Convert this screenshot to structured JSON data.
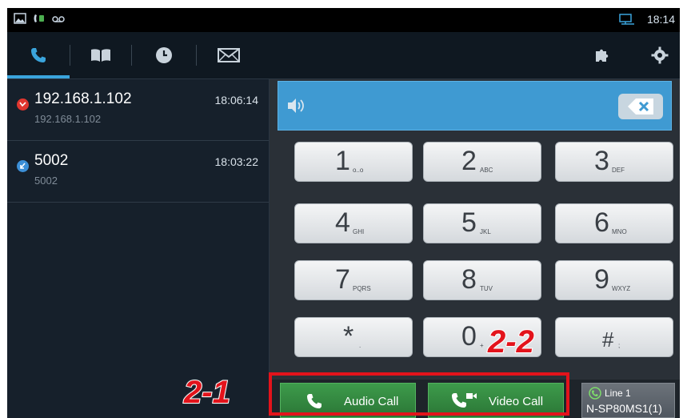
{
  "status_bar": {
    "time": "18:14"
  },
  "tabs": [
    {
      "name": "dialer",
      "icon": "phone-icon",
      "active": true
    },
    {
      "name": "directory",
      "icon": "book-icon",
      "active": false
    },
    {
      "name": "history",
      "icon": "clock-icon",
      "active": false
    },
    {
      "name": "messages",
      "icon": "envelope-icon",
      "active": false
    }
  ],
  "toolbar_icons": [
    "puzzle-icon",
    "gear-icon"
  ],
  "call_history": [
    {
      "title": "192.168.1.102",
      "subtitle": "192.168.1.102",
      "time": "18:06:14",
      "type": "missed",
      "icon_color": "#e0362f"
    },
    {
      "title": "5002",
      "subtitle": "5002",
      "time": "18:03:22",
      "type": "incoming",
      "icon_color": "#3c8fd6"
    }
  ],
  "keypad": [
    {
      "digit": "1",
      "letters": "o..o"
    },
    {
      "digit": "2",
      "letters": "ABC"
    },
    {
      "digit": "3",
      "letters": "DEF"
    },
    {
      "digit": "4",
      "letters": "GHI"
    },
    {
      "digit": "5",
      "letters": "JKL"
    },
    {
      "digit": "6",
      "letters": "MNO"
    },
    {
      "digit": "7",
      "letters": "PQRS"
    },
    {
      "digit": "8",
      "letters": "TUV"
    },
    {
      "digit": "9",
      "letters": "WXYZ"
    },
    {
      "digit": "*",
      "letters": "."
    },
    {
      "digit": "0",
      "letters": "+"
    },
    {
      "digit": "#",
      "letters": ";"
    }
  ],
  "buttons": {
    "audio_call": "Audio Call",
    "video_call": "Video Call",
    "line_label": "Line 1",
    "line_account": "N-SP80MS1(1)"
  },
  "annotations": {
    "callout_1": "2-1",
    "callout_2": "2-2"
  },
  "colors": {
    "accent": "#3aa4dc",
    "number_bar": "#3f9ad2",
    "call_green": "#3d9b4b",
    "annotation_red": "#e3131b"
  }
}
